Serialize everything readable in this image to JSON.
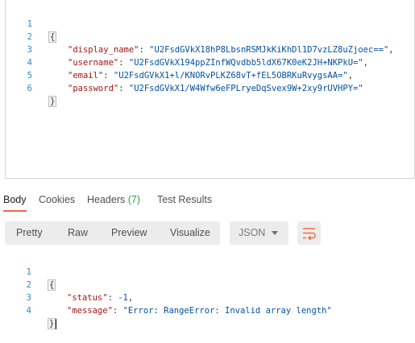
{
  "request_editor": {
    "lines": [
      {
        "num": "1",
        "key": "",
        "value": "",
        "suffix": "",
        "type": "open"
      },
      {
        "num": "2",
        "key": "\"display_name\"",
        "value": "\"U2FsdGVkX18hP8LbsnRSMJkKiKhDl1D7vzLZ8uZjoec==\"",
        "suffix": ",",
        "type": "kv"
      },
      {
        "num": "3",
        "key": "\"username\"",
        "value": "\"U2FsdGVkX194ppZInfWQvdbb5ldX67K0eK2JH+NKPkU=\"",
        "suffix": ",",
        "type": "kv"
      },
      {
        "num": "4",
        "key": "\"email\"",
        "value": "\"U2FsdGVkX1+l/KNORvPLKZ68vT+fEL5OBRKuRvygsAA=\"",
        "suffix": ",",
        "type": "kv"
      },
      {
        "num": "5",
        "key": "\"password\"",
        "value": "\"U2FsdGVkX1/W4Wfw6eFPLryeDqSvex9W+2xy9rUVHPY=\"",
        "suffix": "",
        "type": "kv"
      },
      {
        "num": "6",
        "key": "",
        "value": "",
        "suffix": "",
        "type": "close"
      }
    ],
    "open_brace": "{",
    "close_brace": "}"
  },
  "response_tabs": {
    "body": "Body",
    "cookies": "Cookies",
    "headers": "Headers",
    "headers_count": "(7)",
    "test_results": "Test Results"
  },
  "toolbar": {
    "pretty": "Pretty",
    "raw": "Raw",
    "preview": "Preview",
    "visualize": "Visualize",
    "format_selected": "JSON",
    "wrap_icon": "wrap-lines-icon"
  },
  "response_body": {
    "lines": [
      {
        "num": "1",
        "key": "",
        "value": "",
        "suffix": "",
        "type": "open"
      },
      {
        "num": "2",
        "key": "\"status\"",
        "value": "-1",
        "suffix": ",",
        "type": "kv"
      },
      {
        "num": "3",
        "key": "\"message\"",
        "value": "\"Error: RangeError: Invalid array length\"",
        "suffix": "",
        "type": "kv"
      },
      {
        "num": "4",
        "key": "",
        "value": "",
        "suffix": "",
        "type": "close"
      }
    ],
    "open_brace": "{",
    "close_brace": "}"
  },
  "colors": {
    "line_numbers": "#2e8bc0",
    "json_key": "#a31515",
    "json_string": "#0451a5",
    "active_tab_underline": "#f26b3a",
    "headers_count": "#2e9f40",
    "wrap_icon": "#f26b3a"
  }
}
